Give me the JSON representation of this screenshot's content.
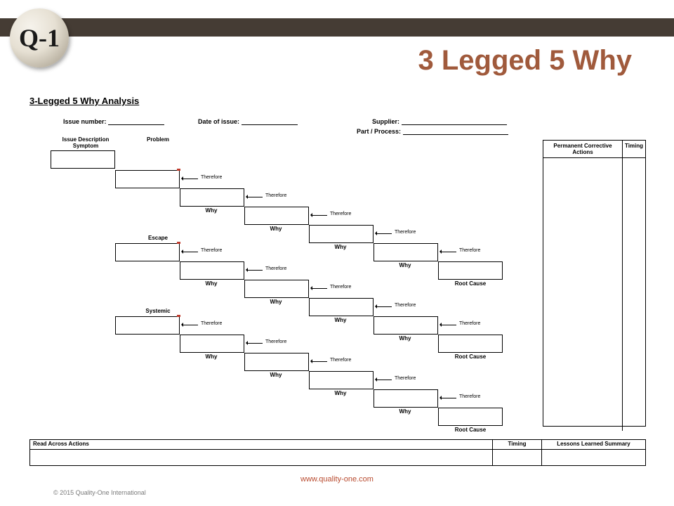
{
  "logo_text": "Q-1",
  "slide_title": "3 Legged 5 Why",
  "subtitle": "3-Legged 5 Why Analysis",
  "fields": {
    "issue_number": "Issue number:",
    "date_of_issue": "Date of issue:",
    "supplier": "Supplier:",
    "part_process": "Part / Process:"
  },
  "labels": {
    "issue_desc_symptom_l1": "Issue Description",
    "issue_desc_symptom_l2": "Symptom",
    "problem": "Problem",
    "escape": "Escape",
    "systemic": "Systemic",
    "why": "Why",
    "therefore": "Therefore",
    "root_cause": "Root Cause",
    "pca": "Permanent Corrective Actions",
    "timing": "Timing",
    "read_across": "Read Across Actions",
    "lessons": "Lessons Learned Summary"
  },
  "url": "www.quality-one.com",
  "copyright": "© 2015 Quality-One International"
}
